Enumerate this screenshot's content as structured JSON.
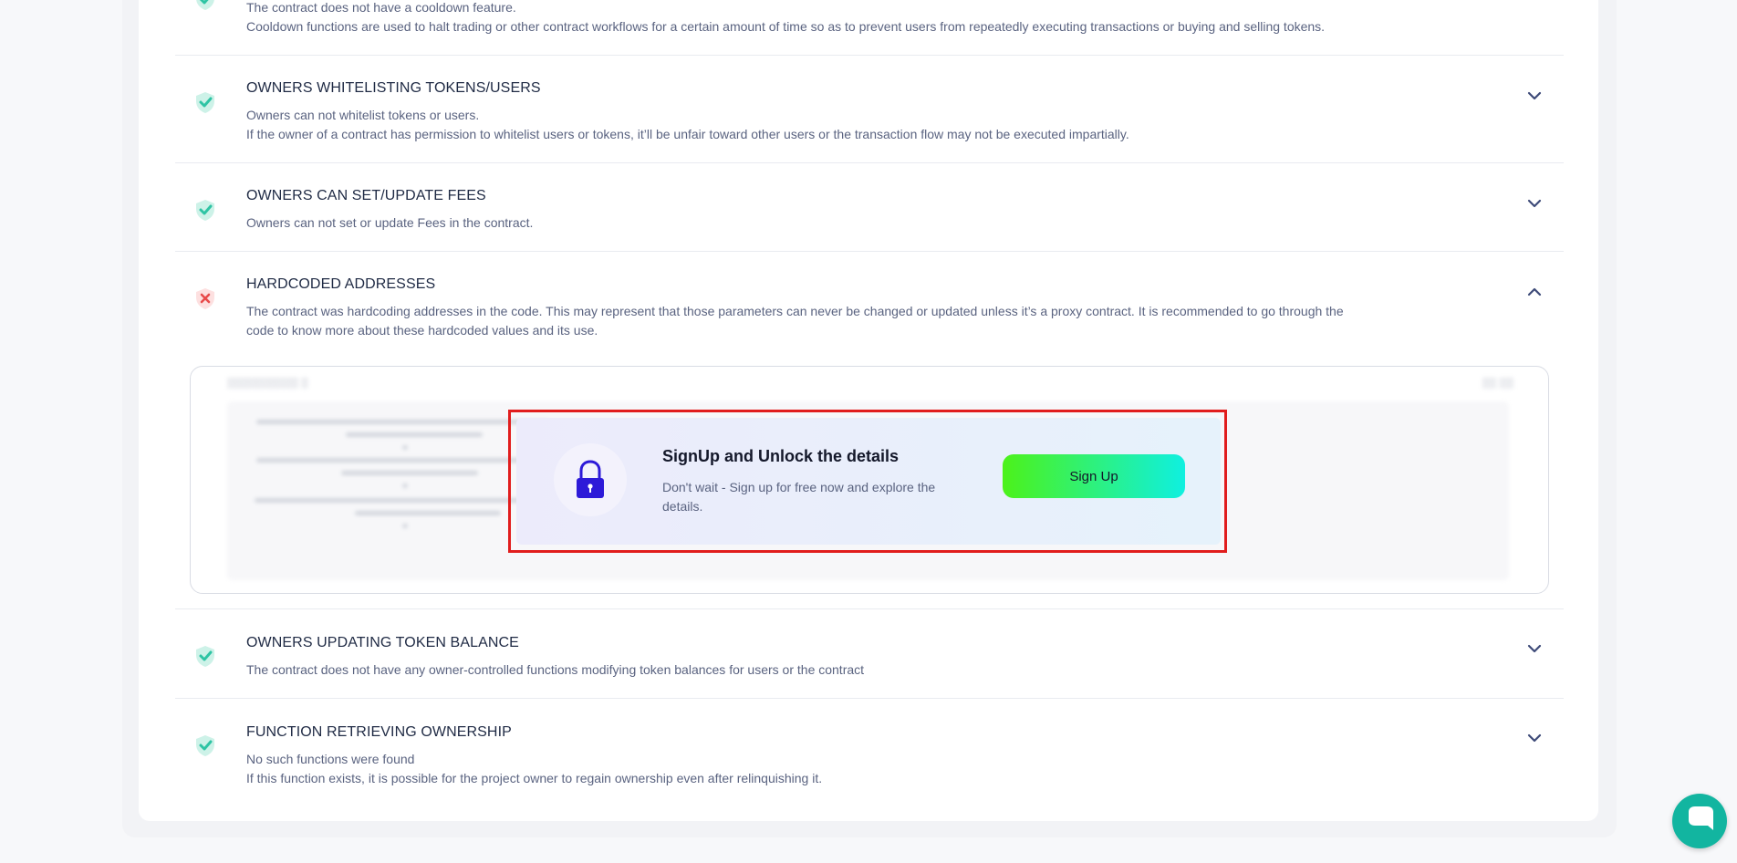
{
  "colors": {
    "pass": "#2ec4a4",
    "fail": "#e84a4a",
    "accent_lock": "#2d1ad8",
    "chat": "#12b5a0"
  },
  "rows": [
    {
      "id": "cooldown",
      "status": "pass",
      "lines": [
        "The contract does not have a cooldown feature.",
        "Cooldown functions are used to halt trading or other contract workflows for a certain amount of time so as to prevent users from repeatedly executing transactions or buying and selling tokens."
      ]
    },
    {
      "id": "whitelist",
      "status": "pass",
      "title": "OWNERS WHITELISTING TOKENS/USERS",
      "lines": [
        "Owners can not whitelist tokens or users.",
        "If the owner of a contract has permission to whitelist users or tokens, it’ll be unfair toward other users or the transaction flow may not be executed impartially."
      ],
      "chevron": "chevron-down-icon"
    },
    {
      "id": "fees",
      "status": "pass",
      "title": "OWNERS CAN SET/UPDATE FEES",
      "lines": [
        "Owners can not set or update Fees in the contract."
      ],
      "chevron": "chevron-down-icon"
    },
    {
      "id": "hardcoded",
      "status": "fail",
      "title": "HARDCODED ADDRESSES",
      "lines": [
        "The contract was hardcoding addresses in the code. This may represent that those parameters can never be changed or updated unless it’s a proxy contract. It is recommended to go through the",
        "code to know more about these hardcoded values and its use."
      ],
      "chevron": "chevron-up-icon"
    },
    {
      "id": "balance",
      "status": "pass",
      "title": "OWNERS UPDATING TOKEN BALANCE",
      "lines": [
        "The contract does not have any owner-controlled functions modifying token balances for users or the contract"
      ],
      "chevron": "chevron-down-icon"
    },
    {
      "id": "ownership",
      "status": "pass",
      "title": "FUNCTION RETRIEVING OWNERSHIP",
      "lines": [
        "No such functions were found",
        "If this function exists, it is possible for the project owner to regain ownership even after relinquishing it."
      ],
      "chevron": "chevron-down-icon"
    }
  ],
  "unlock": {
    "title": "SignUp and Unlock the details",
    "description": "Don't wait - Sign up for free now and explore the details.",
    "button_label": "Sign Up"
  }
}
